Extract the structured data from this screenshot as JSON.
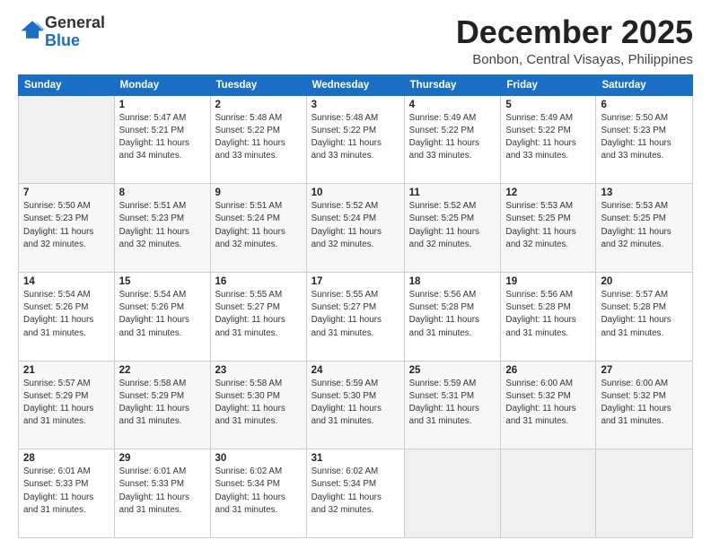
{
  "logo": {
    "general": "General",
    "blue": "Blue"
  },
  "header": {
    "month": "December 2025",
    "location": "Bonbon, Central Visayas, Philippines"
  },
  "weekdays": [
    "Sunday",
    "Monday",
    "Tuesday",
    "Wednesday",
    "Thursday",
    "Friday",
    "Saturday"
  ],
  "weeks": [
    [
      {
        "day": "",
        "info": ""
      },
      {
        "day": "1",
        "info": "Sunrise: 5:47 AM\nSunset: 5:21 PM\nDaylight: 11 hours\nand 34 minutes."
      },
      {
        "day": "2",
        "info": "Sunrise: 5:48 AM\nSunset: 5:22 PM\nDaylight: 11 hours\nand 33 minutes."
      },
      {
        "day": "3",
        "info": "Sunrise: 5:48 AM\nSunset: 5:22 PM\nDaylight: 11 hours\nand 33 minutes."
      },
      {
        "day": "4",
        "info": "Sunrise: 5:49 AM\nSunset: 5:22 PM\nDaylight: 11 hours\nand 33 minutes."
      },
      {
        "day": "5",
        "info": "Sunrise: 5:49 AM\nSunset: 5:22 PM\nDaylight: 11 hours\nand 33 minutes."
      },
      {
        "day": "6",
        "info": "Sunrise: 5:50 AM\nSunset: 5:23 PM\nDaylight: 11 hours\nand 33 minutes."
      }
    ],
    [
      {
        "day": "7",
        "info": "Sunrise: 5:50 AM\nSunset: 5:23 PM\nDaylight: 11 hours\nand 32 minutes."
      },
      {
        "day": "8",
        "info": "Sunrise: 5:51 AM\nSunset: 5:23 PM\nDaylight: 11 hours\nand 32 minutes."
      },
      {
        "day": "9",
        "info": "Sunrise: 5:51 AM\nSunset: 5:24 PM\nDaylight: 11 hours\nand 32 minutes."
      },
      {
        "day": "10",
        "info": "Sunrise: 5:52 AM\nSunset: 5:24 PM\nDaylight: 11 hours\nand 32 minutes."
      },
      {
        "day": "11",
        "info": "Sunrise: 5:52 AM\nSunset: 5:25 PM\nDaylight: 11 hours\nand 32 minutes."
      },
      {
        "day": "12",
        "info": "Sunrise: 5:53 AM\nSunset: 5:25 PM\nDaylight: 11 hours\nand 32 minutes."
      },
      {
        "day": "13",
        "info": "Sunrise: 5:53 AM\nSunset: 5:25 PM\nDaylight: 11 hours\nand 32 minutes."
      }
    ],
    [
      {
        "day": "14",
        "info": "Sunrise: 5:54 AM\nSunset: 5:26 PM\nDaylight: 11 hours\nand 31 minutes."
      },
      {
        "day": "15",
        "info": "Sunrise: 5:54 AM\nSunset: 5:26 PM\nDaylight: 11 hours\nand 31 minutes."
      },
      {
        "day": "16",
        "info": "Sunrise: 5:55 AM\nSunset: 5:27 PM\nDaylight: 11 hours\nand 31 minutes."
      },
      {
        "day": "17",
        "info": "Sunrise: 5:55 AM\nSunset: 5:27 PM\nDaylight: 11 hours\nand 31 minutes."
      },
      {
        "day": "18",
        "info": "Sunrise: 5:56 AM\nSunset: 5:28 PM\nDaylight: 11 hours\nand 31 minutes."
      },
      {
        "day": "19",
        "info": "Sunrise: 5:56 AM\nSunset: 5:28 PM\nDaylight: 11 hours\nand 31 minutes."
      },
      {
        "day": "20",
        "info": "Sunrise: 5:57 AM\nSunset: 5:28 PM\nDaylight: 11 hours\nand 31 minutes."
      }
    ],
    [
      {
        "day": "21",
        "info": "Sunrise: 5:57 AM\nSunset: 5:29 PM\nDaylight: 11 hours\nand 31 minutes."
      },
      {
        "day": "22",
        "info": "Sunrise: 5:58 AM\nSunset: 5:29 PM\nDaylight: 11 hours\nand 31 minutes."
      },
      {
        "day": "23",
        "info": "Sunrise: 5:58 AM\nSunset: 5:30 PM\nDaylight: 11 hours\nand 31 minutes."
      },
      {
        "day": "24",
        "info": "Sunrise: 5:59 AM\nSunset: 5:30 PM\nDaylight: 11 hours\nand 31 minutes."
      },
      {
        "day": "25",
        "info": "Sunrise: 5:59 AM\nSunset: 5:31 PM\nDaylight: 11 hours\nand 31 minutes."
      },
      {
        "day": "26",
        "info": "Sunrise: 6:00 AM\nSunset: 5:32 PM\nDaylight: 11 hours\nand 31 minutes."
      },
      {
        "day": "27",
        "info": "Sunrise: 6:00 AM\nSunset: 5:32 PM\nDaylight: 11 hours\nand 31 minutes."
      }
    ],
    [
      {
        "day": "28",
        "info": "Sunrise: 6:01 AM\nSunset: 5:33 PM\nDaylight: 11 hours\nand 31 minutes."
      },
      {
        "day": "29",
        "info": "Sunrise: 6:01 AM\nSunset: 5:33 PM\nDaylight: 11 hours\nand 31 minutes."
      },
      {
        "day": "30",
        "info": "Sunrise: 6:02 AM\nSunset: 5:34 PM\nDaylight: 11 hours\nand 31 minutes."
      },
      {
        "day": "31",
        "info": "Sunrise: 6:02 AM\nSunset: 5:34 PM\nDaylight: 11 hours\nand 32 minutes."
      },
      {
        "day": "",
        "info": ""
      },
      {
        "day": "",
        "info": ""
      },
      {
        "day": "",
        "info": ""
      }
    ]
  ]
}
